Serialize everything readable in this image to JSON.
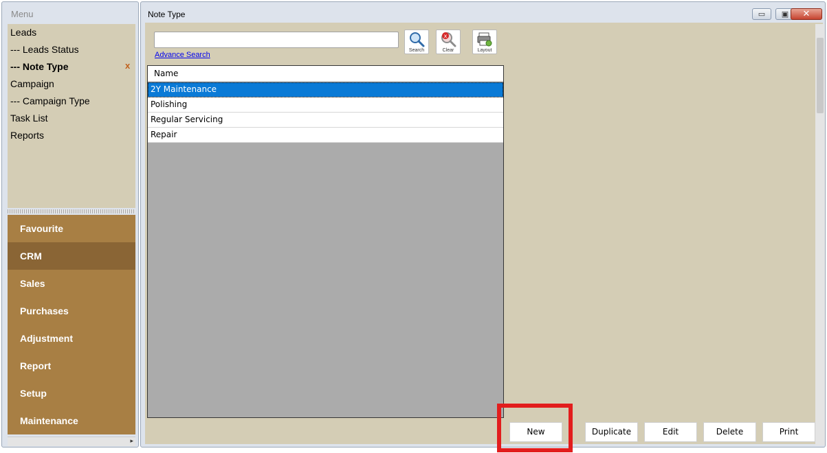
{
  "menu": {
    "header": "Menu",
    "items": [
      {
        "label": "Leads"
      },
      {
        "label": "--- Leads Status"
      },
      {
        "label": "--- Note Type"
      },
      {
        "label": "Campaign"
      },
      {
        "label": "--- Campaign Type"
      },
      {
        "label": "Task List"
      },
      {
        "label": "Reports"
      }
    ],
    "selected_item": "--- Note Type",
    "close_marker": "x",
    "modules": [
      {
        "label": "Favourite"
      },
      {
        "label": "CRM"
      },
      {
        "label": "Sales"
      },
      {
        "label": "Purchases"
      },
      {
        "label": "Adjustment"
      },
      {
        "label": "Report"
      },
      {
        "label": "Setup"
      },
      {
        "label": "Maintenance"
      }
    ],
    "active_module": "CRM"
  },
  "window": {
    "title": "Note Type",
    "controls": {
      "minimize": "▭",
      "maximize": "▣",
      "close": "✕"
    }
  },
  "toolbar": {
    "search_value": "",
    "advance_search": "Advance Search",
    "search_label": "Search",
    "clear_label": "Clear",
    "layout_label": "Layout"
  },
  "grid": {
    "header": "Name",
    "rows": [
      {
        "name": "2Y Maintenance",
        "selected": true
      },
      {
        "name": "Polishing",
        "selected": false
      },
      {
        "name": "Regular Servicing",
        "selected": false
      },
      {
        "name": "Repair",
        "selected": false
      }
    ]
  },
  "actions": {
    "new": "New",
    "duplicate": "Duplicate",
    "edit": "Edit",
    "delete": "Delete",
    "print": "Print"
  },
  "colors": {
    "module_bg": "#a87f44",
    "module_active_bg": "#8a6535",
    "panel_bg": "#d4cdb5",
    "selection": "#0a7ad6",
    "highlight": "#e21d1d"
  },
  "icons": {
    "search": "search-icon",
    "clear": "clear-icon",
    "layout": "layout-icon"
  }
}
